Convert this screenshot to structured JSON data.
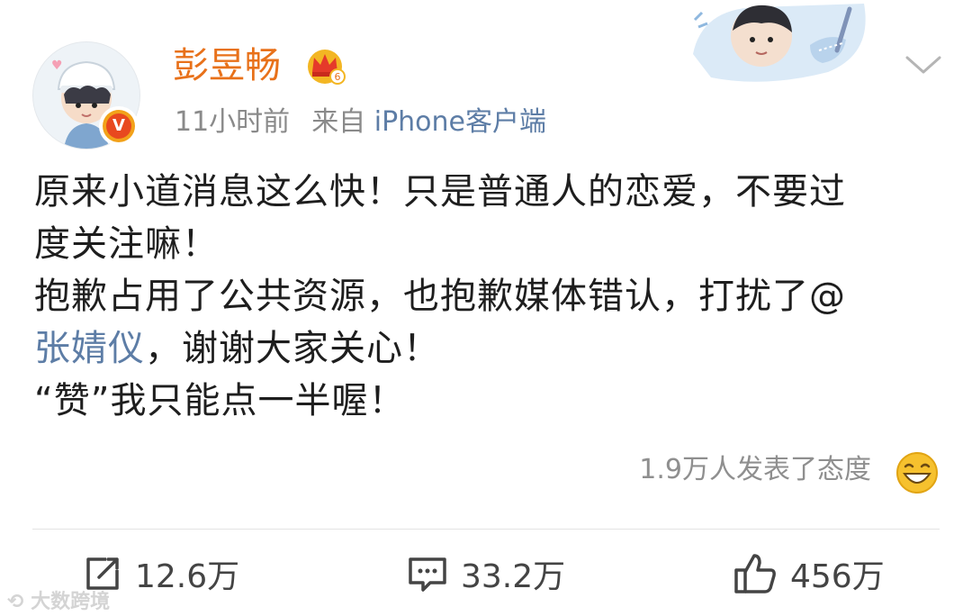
{
  "post": {
    "username": "彭昱畅",
    "time": "11小时前",
    "source_prefix": "来自",
    "source": "iPhone客户端",
    "content": {
      "line1": "原来小道消息这么快！只是普通人的恋爱，不要过",
      "line2": "度关注嘛！",
      "line3": "抱歉占用了公共资源，也抱歉媒体错认，打扰了@",
      "mention": "张婧仪",
      "line4_rest": "，谢谢大家关心！",
      "line5": "“赞”我只能点一半喔！"
    },
    "reactions_text": "1.9万人发表了态度"
  },
  "actions": {
    "repost_count": "12.6万",
    "comment_count": "33.2万",
    "like_count": "456万"
  },
  "watermark": "大数跨境",
  "icons": [
    "verified-v-icon",
    "crown-icon",
    "chevron-down-icon",
    "laugh-emoji-icon",
    "repost-icon",
    "comment-icon",
    "like-icon"
  ],
  "colors": {
    "username": "#e8711a",
    "link": "#5d7da6",
    "meta": "#8a8a8a",
    "text": "#1e1e1e"
  }
}
